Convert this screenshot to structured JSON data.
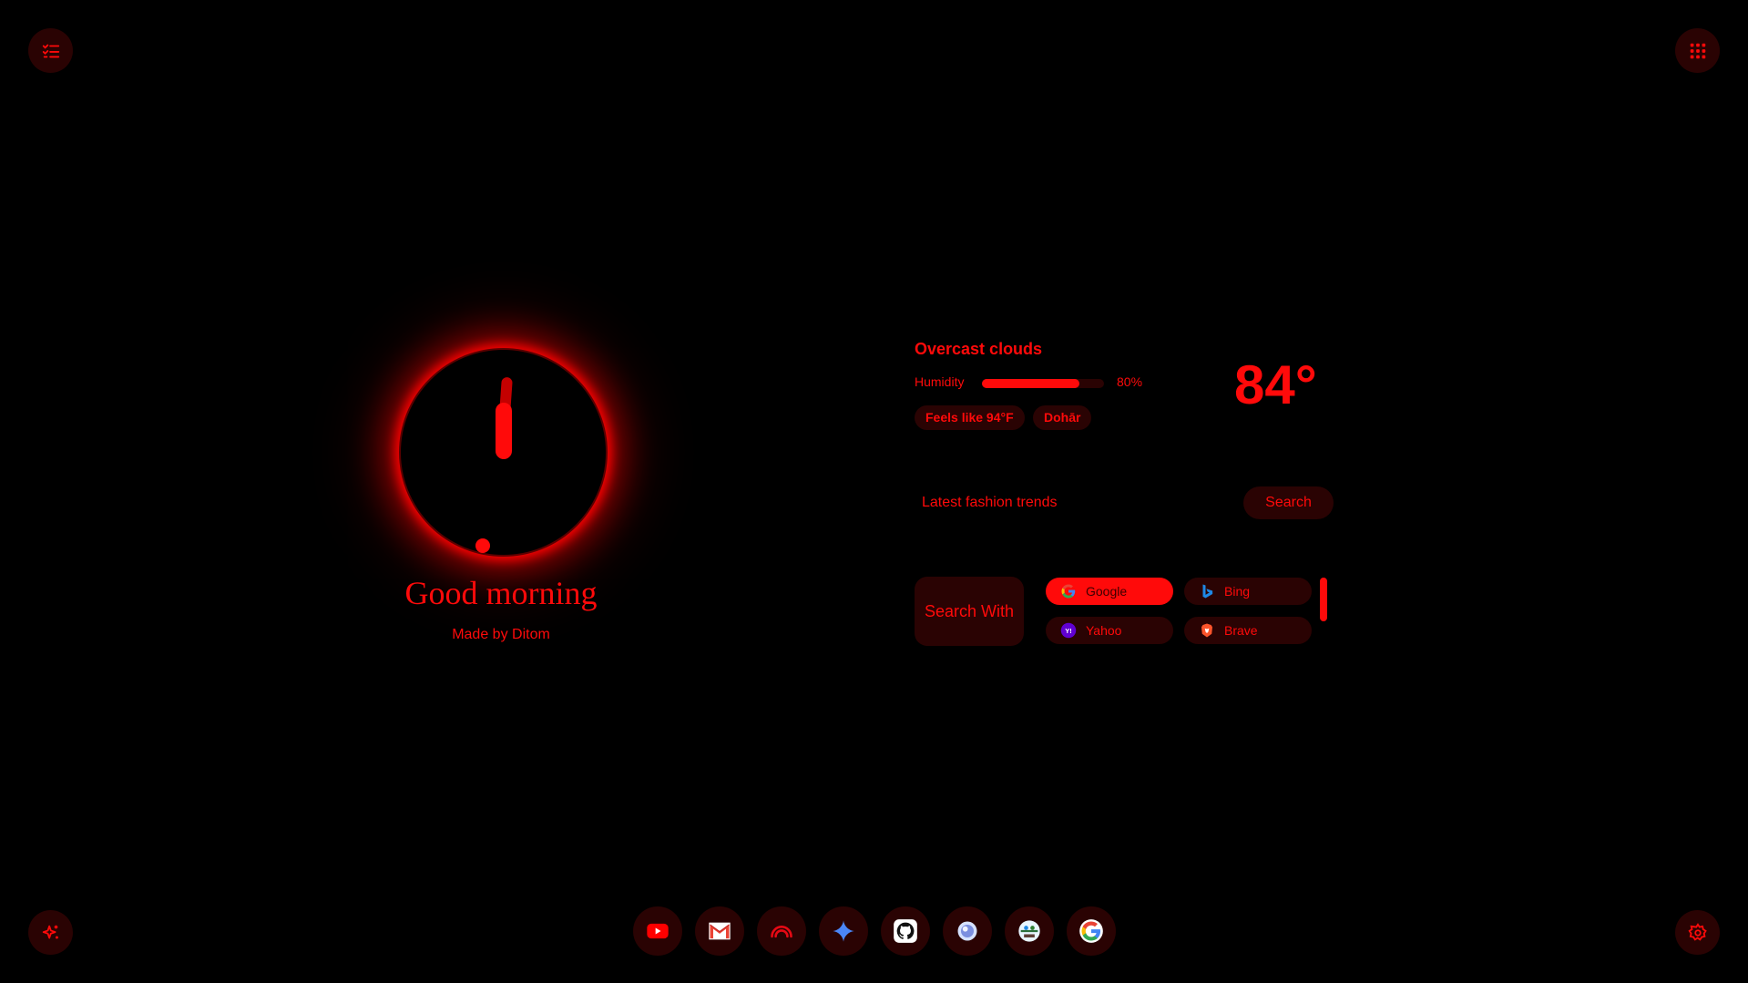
{
  "corners": {
    "top_left": {
      "icon": "checklist-icon"
    },
    "top_right": {
      "icon": "apps-grid-icon"
    },
    "bottom_left": {
      "icon": "sparkle-icon"
    },
    "bottom_right": {
      "icon": "gear-icon"
    }
  },
  "clock": {
    "greeting": "Good morning",
    "credit": "Made by Ditom"
  },
  "weather": {
    "condition": "Overcast clouds",
    "humidity_label": "Humidity",
    "humidity_value": "80%",
    "humidity_fraction": 0.8,
    "feels_like": "Feels like 94°F",
    "location": "Dohār",
    "temperature": "84°"
  },
  "search": {
    "query": "Latest fashion trends",
    "button_label": "Search",
    "search_with_label": "Search With",
    "engines": [
      {
        "name": "Google",
        "icon": "google-icon",
        "active": true
      },
      {
        "name": "Bing",
        "icon": "bing-icon",
        "active": false
      },
      {
        "name": "Yahoo",
        "icon": "yahoo-icon",
        "active": false
      },
      {
        "name": "Brave",
        "icon": "brave-icon",
        "active": false
      }
    ]
  },
  "dock": [
    {
      "icon": "youtube-icon"
    },
    {
      "icon": "gmail-icon"
    },
    {
      "icon": "speedometer-icon"
    },
    {
      "icon": "gemini-icon"
    },
    {
      "icon": "github-icon"
    },
    {
      "icon": "globe-icon"
    },
    {
      "icon": "app-icon"
    },
    {
      "icon": "google-icon"
    }
  ],
  "colors": {
    "accent": "#ff0a0a",
    "surface": "#2a0303",
    "background": "#000000"
  }
}
